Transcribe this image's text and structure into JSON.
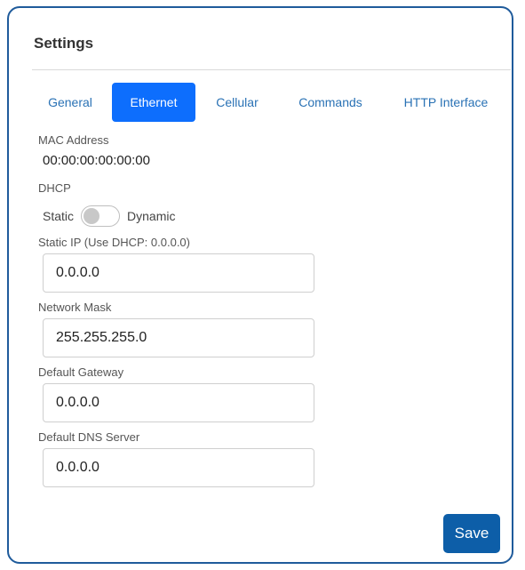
{
  "panel": {
    "title": "Settings"
  },
  "tabs": [
    {
      "label": "General",
      "active": false
    },
    {
      "label": "Ethernet",
      "active": true
    },
    {
      "label": "Cellular",
      "active": false
    },
    {
      "label": "Commands",
      "active": false
    },
    {
      "label": "HTTP Interface",
      "active": false
    }
  ],
  "mac": {
    "label": "MAC Address",
    "value": "00:00:00:00:00:00"
  },
  "dhcp": {
    "label": "DHCP",
    "left_option": "Static",
    "right_option": "Dynamic",
    "state": "Static"
  },
  "fields": {
    "static_ip": {
      "label": "Static IP (Use DHCP: 0.0.0.0)",
      "value": "0.0.0.0"
    },
    "network_mask": {
      "label": "Network Mask",
      "value": "255.255.255.0"
    },
    "default_gateway": {
      "label": "Default Gateway",
      "value": "0.0.0.0"
    },
    "default_dns": {
      "label": "Default DNS Server",
      "value": "0.0.0.0"
    }
  },
  "actions": {
    "save_label": "Save"
  },
  "colors": {
    "accent": "#0d6efd",
    "link": "#2a72b5",
    "save": "#0d5ea8",
    "border": "#1f5b9b"
  }
}
